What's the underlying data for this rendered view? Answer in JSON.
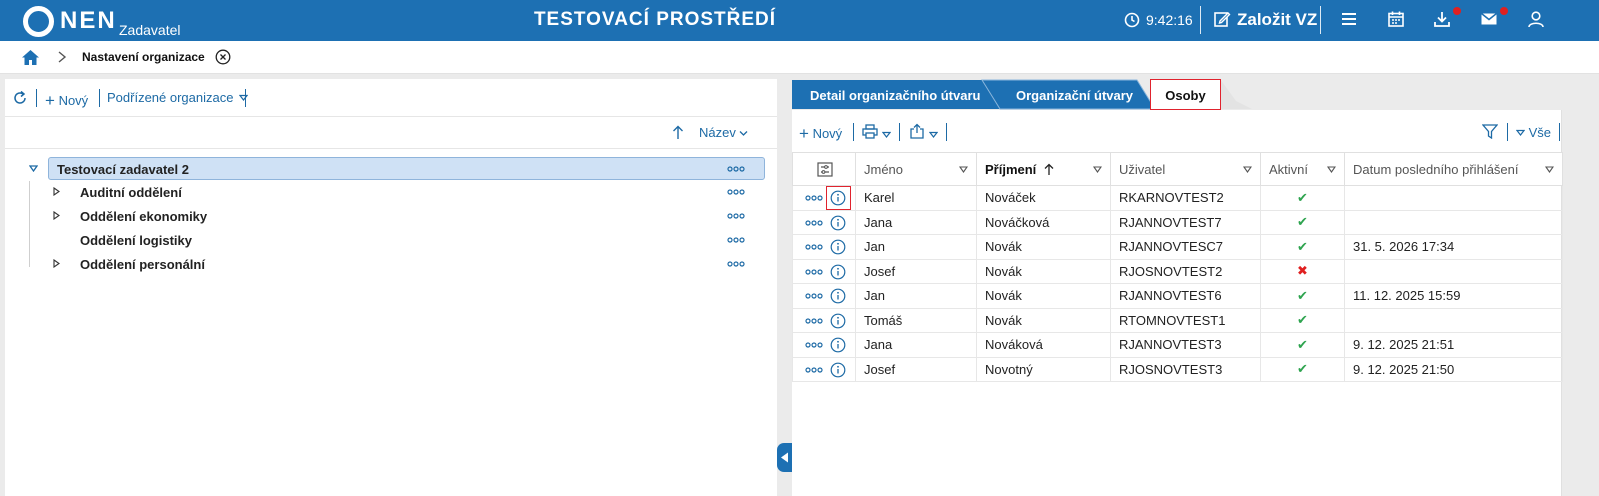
{
  "app": {
    "logo_name": "NEN",
    "logo_subtitle": "Zadavatel",
    "environment_title": "TESTOVACÍ PROSTŘEDÍ",
    "clock_time": "9:42:16",
    "create_button_label": "Založit VZ",
    "brand_color": "#1d70b3",
    "icons": [
      "clock-icon",
      "edit-icon",
      "menu-icon",
      "calendar-icon",
      "download-icon",
      "mail-icon",
      "user-icon"
    ]
  },
  "breadcrumb": {
    "current": "Nastavení organizace"
  },
  "left": {
    "toolbar": {
      "new_label": "Nový",
      "sub_org_label": "Podřízené organizace"
    },
    "sort_label": "Název",
    "tree": {
      "root": "Testovací zadavatel 2",
      "children": [
        {
          "label": "Auditní oddělení",
          "expandable": true
        },
        {
          "label": "Oddělení ekonomiky",
          "expandable": true
        },
        {
          "label": "Oddělení logistiky",
          "expandable": false
        },
        {
          "label": "Oddělení personální",
          "expandable": true
        }
      ]
    }
  },
  "right": {
    "tabs": [
      "Detail organizačního útvaru",
      "Organizační útvary",
      "Osoby"
    ],
    "active_tab": "Osoby",
    "toolbar": {
      "new_label": "Nový",
      "all_label": "Vše"
    },
    "columns": [
      "Jméno",
      "Příjmení",
      "Uživatel",
      "Aktivní",
      "Datum posledního přihlášení"
    ],
    "sorted_column": "Příjmení",
    "rows": [
      {
        "jmeno": "Karel",
        "prijmeni": "Nováček",
        "uzivatel": "RKARNOVTEST2",
        "aktivni": "✔",
        "datum": ""
      },
      {
        "jmeno": "Jana",
        "prijmeni": "Nováčková",
        "uzivatel": "RJANNOVTEST7",
        "aktivni": "✔",
        "datum": ""
      },
      {
        "jmeno": "Jan",
        "prijmeni": "Novák",
        "uzivatel": "RJANNOVTESC7",
        "aktivni": "✔",
        "datum": "31. 5. 2026 17:34"
      },
      {
        "jmeno": "Josef",
        "prijmeni": "Novák",
        "uzivatel": "RJOSNOVTEST2",
        "aktivni": "✖",
        "datum": ""
      },
      {
        "jmeno": "Jan",
        "prijmeni": "Novák",
        "uzivatel": "RJANNOVTEST6",
        "aktivni": "✔",
        "datum": "11. 12. 2025 15:59"
      },
      {
        "jmeno": "Tomáš",
        "prijmeni": "Novák",
        "uzivatel": "RTOMNOVTEST1",
        "aktivni": "✔",
        "datum": ""
      },
      {
        "jmeno": "Jana",
        "prijmeni": "Nováková",
        "uzivatel": "RJANNOVTEST3",
        "aktivni": "✔",
        "datum": "9. 12. 2025 21:51"
      },
      {
        "jmeno": "Josef",
        "prijmeni": "Novotný",
        "uzivatel": "RJOSNOVTEST3",
        "aktivni": "✔",
        "datum": "9. 12. 2025 21:50"
      }
    ]
  },
  "colors": {
    "active_check": "#2ea44f",
    "inactive_cross": "#e02020",
    "highlight_border": "#e0232e"
  }
}
